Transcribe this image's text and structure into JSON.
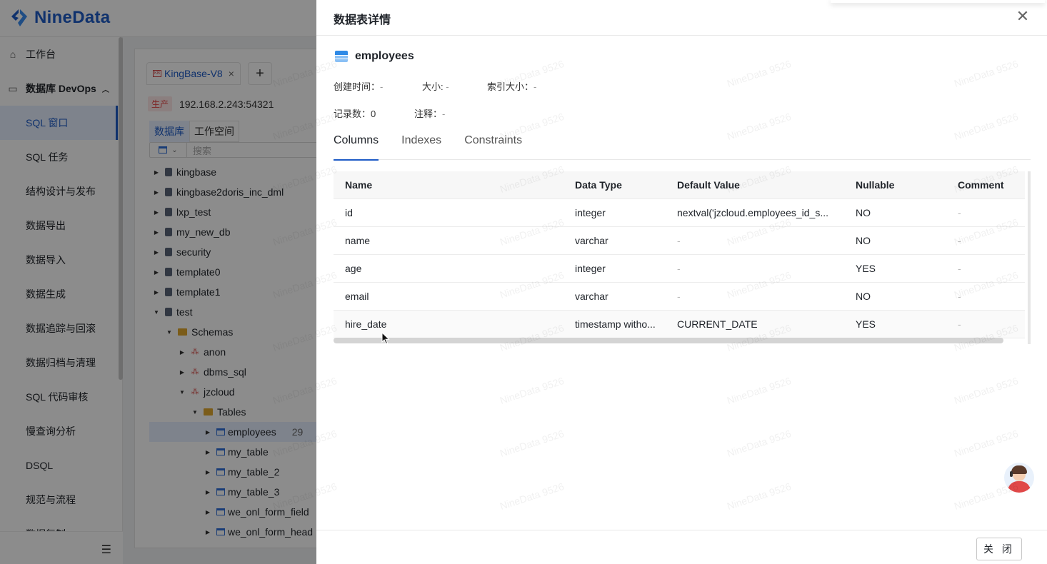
{
  "app": {
    "logo_text": "NineData",
    "brand_color": "#1e5bc6"
  },
  "sidebar": {
    "workbench": "工作台",
    "group": "数据库 DevOps",
    "items": [
      {
        "label": "SQL 窗口",
        "active": true
      },
      {
        "label": "SQL 任务"
      },
      {
        "label": "结构设计与发布"
      },
      {
        "label": "数据导出"
      },
      {
        "label": "数据导入"
      },
      {
        "label": "数据生成"
      },
      {
        "label": "数据追踪与回滚"
      },
      {
        "label": "数据归档与清理"
      },
      {
        "label": "SQL 代码审核"
      },
      {
        "label": "慢查询分析"
      },
      {
        "label": "DSQL"
      },
      {
        "label": "规范与流程"
      },
      {
        "label": "数据复制"
      }
    ]
  },
  "workspace": {
    "tab_label": "KingBase-V8",
    "env_badge": "生产",
    "host": "192.168.2.243:54321",
    "subtabs": [
      "数据库",
      "工作空间"
    ],
    "search_placeholder": "搜索",
    "tree": [
      {
        "label": "kingbase",
        "type": "db",
        "level": 0
      },
      {
        "label": "kingbase2doris_inc_dml",
        "type": "db",
        "level": 0
      },
      {
        "label": "lxp_test",
        "type": "db",
        "level": 0
      },
      {
        "label": "my_new_db",
        "type": "db",
        "level": 0
      },
      {
        "label": "security",
        "type": "db",
        "level": 0
      },
      {
        "label": "template0",
        "type": "db",
        "level": 0
      },
      {
        "label": "template1",
        "type": "db",
        "level": 0
      },
      {
        "label": "test",
        "type": "db",
        "level": 0,
        "open": true
      },
      {
        "label": "Schemas",
        "type": "folder",
        "level": 1,
        "open": true
      },
      {
        "label": "anon",
        "type": "schema",
        "level": 2
      },
      {
        "label": "dbms_sql",
        "type": "schema",
        "level": 2
      },
      {
        "label": "jzcloud",
        "type": "schema",
        "level": 2,
        "open": true
      },
      {
        "label": "Tables",
        "type": "folder",
        "level": 3,
        "open": true
      },
      {
        "label": "employees",
        "type": "table",
        "level": 4,
        "selected": true,
        "count": "29"
      },
      {
        "label": "my_table",
        "type": "table",
        "level": 4
      },
      {
        "label": "my_table_2",
        "type": "table",
        "level": 4
      },
      {
        "label": "my_table_3",
        "type": "table",
        "level": 4
      },
      {
        "label": "we_onl_form_field",
        "type": "table",
        "level": 4
      },
      {
        "label": "we_onl_form_head",
        "type": "table",
        "level": 4
      }
    ]
  },
  "drawer": {
    "title": "数据表详情",
    "table_name": "employees",
    "meta": {
      "created_label": "创建时间：",
      "created_value": "-",
      "size_label": "大小:",
      "size_value": "-",
      "index_size_label": "索引大小：",
      "index_size_value": "-",
      "rows_label": "记录数：",
      "rows_value": "0",
      "comment_label": "注释：",
      "comment_value": "-"
    },
    "tabs": [
      "Columns",
      "Indexes",
      "Constraints"
    ],
    "active_tab": "Columns",
    "columns_header": [
      "Name",
      "Data Type",
      "Default Value",
      "Nullable",
      "Comment"
    ],
    "rows": [
      [
        "id",
        "integer",
        "nextval('jzcloud.employees_id_s...",
        "NO",
        "-"
      ],
      [
        "name",
        "varchar",
        "-",
        "NO",
        "-"
      ],
      [
        "age",
        "integer",
        "-",
        "YES",
        "-"
      ],
      [
        "email",
        "varchar",
        "-",
        "NO",
        "-"
      ],
      [
        "hire_date",
        "timestamp witho...",
        "CURRENT_DATE",
        "YES",
        "-"
      ]
    ],
    "close_button": "关 闭",
    "watermark": "NineData 9526"
  }
}
